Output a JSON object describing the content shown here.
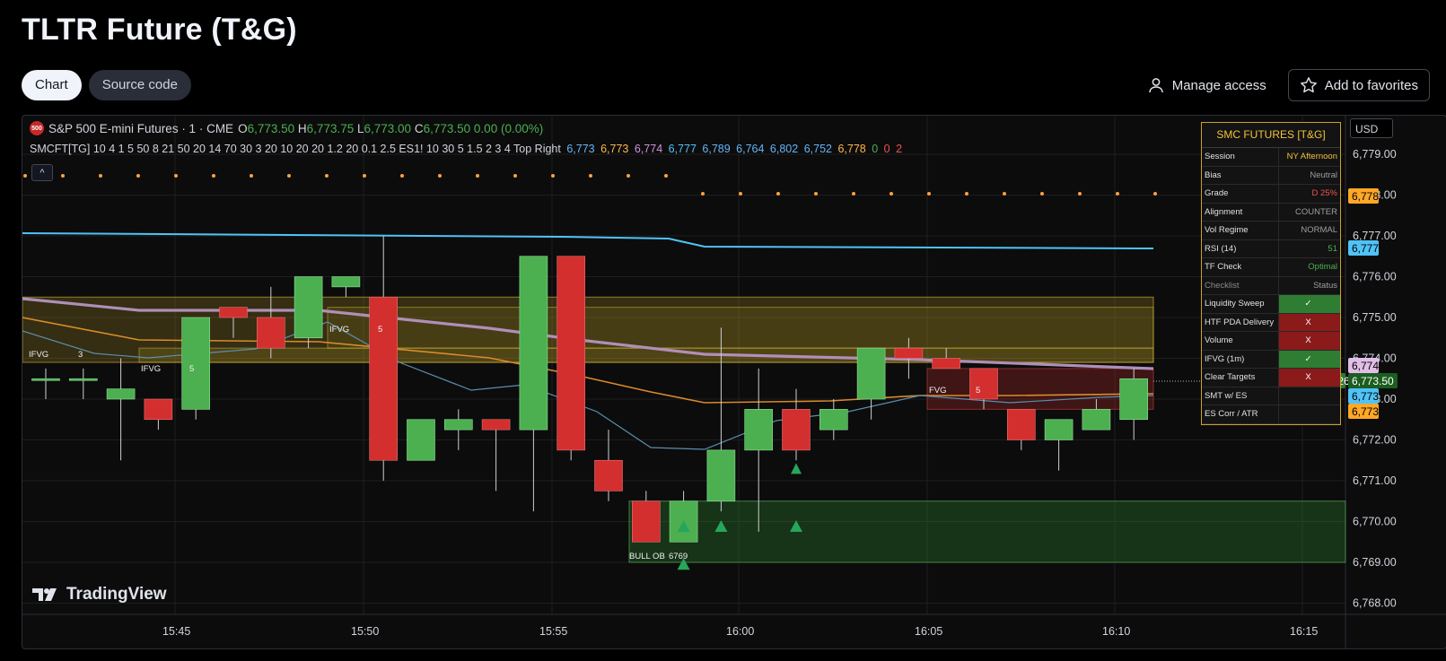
{
  "page": {
    "title": "TLTR Future (T&G)"
  },
  "tabs": [
    {
      "label": "Chart",
      "active": true
    },
    {
      "label": "Source code",
      "active": false
    }
  ],
  "actions": {
    "manage_access": "Manage access",
    "add_favorites": "Add to favorites"
  },
  "chart": {
    "symbol_badge": "500",
    "symbol": "S&P 500 E-mini Futures · 1 · CME",
    "ohlc": {
      "o_label": "O",
      "o": "6,773.50",
      "h_label": "H",
      "h": "6,773.75",
      "l_label": "L",
      "l": "6,773.00",
      "c_label": "C",
      "c": "6,773.50",
      "change": "0.00 (0.00%)"
    },
    "indicator_params": "SMCFT[TG] 10 4 1 5 50 8 21 50 20 14 70 30 3 20 10 20 20 1.2 20 0.1 2.5 ES1! 10 30 5 1.5 2 3 4 Top Right",
    "indicator_values": [
      {
        "text": "6,773",
        "color": "#64b5f6"
      },
      {
        "text": "6,773",
        "color": "#ffb74d"
      },
      {
        "text": "6,774",
        "color": "#ce93d8"
      },
      {
        "text": "6,777",
        "color": "#4fc3f7"
      },
      {
        "text": "6,789",
        "color": "#64b5f6"
      },
      {
        "text": "6,764",
        "color": "#64b5f6"
      },
      {
        "text": "6,802",
        "color": "#64b5f6"
      },
      {
        "text": "6,752",
        "color": "#64b5f6"
      },
      {
        "text": "6,778",
        "color": "#ffb74d"
      },
      {
        "text": "0",
        "color": "#4caf50"
      },
      {
        "text": "0",
        "color": "#ef5350"
      },
      {
        "text": "2",
        "color": "#ef5350"
      }
    ],
    "collapse_glyph": "^",
    "currency": "USD",
    "watermark": "TradingView",
    "y_ticks": [
      "6,779.00",
      "6,778.00",
      "6,777.00",
      "6,776.00",
      "6,775.00",
      "6,774.00",
      "6,773.00",
      "6,772.00",
      "6,771.00",
      "6,770.00",
      "6,769.00",
      "6,768.00"
    ],
    "x_ticks": [
      "15:45",
      "15:50",
      "15:55",
      "16:00",
      "16:05",
      "16:10",
      "16:15"
    ],
    "zone_labels": {
      "ifvg1": "IFVG",
      "ifvg1_num": "3",
      "ifvg2": "IFVG",
      "ifvg2_num": "5",
      "ifvg3": "IFVG",
      "ifvg3_num": "5",
      "fvg": "FVG",
      "fvg_num": "5",
      "bull_ob": "BULL OB",
      "bull_ob_num": "6769"
    },
    "price_tags": {
      "t6778": "6,778",
      "t6777": "6,777",
      "t6774": "6,774",
      "esm_label": "ESM2026",
      "esm_price": "6,773.50",
      "t6773a": "6,773",
      "t6773b": "6,773"
    },
    "colors": {
      "up": "#4caf50",
      "down": "#d32f2f",
      "accent": "#f2c23b",
      "background": "#0c0c0c"
    }
  },
  "smc_panel": {
    "title": "SMC FUTURES  [T&G]",
    "rows": [
      {
        "label": "Session",
        "value": "NY Afternoon",
        "value_color": "#f2c23b"
      },
      {
        "label": "Bias",
        "value": "Neutral"
      },
      {
        "label": "Grade",
        "value": "D  25%",
        "value_color": "#ef5350"
      },
      {
        "label": "Alignment",
        "value": "COUNTER"
      },
      {
        "label": "Vol Regime",
        "value": "NORMAL"
      },
      {
        "label": "RSI (14)",
        "value": "51",
        "value_color": "#4caf50"
      },
      {
        "label": "TF Check",
        "value": "Optimal",
        "value_color": "#4caf50"
      },
      {
        "label": "Checklist",
        "value": "Status",
        "dim": true
      },
      {
        "label": "Liquidity Sweep",
        "value": "✓",
        "cell": "green"
      },
      {
        "label": "HTF PDA Delivery",
        "value": "X",
        "cell": "red"
      },
      {
        "label": "Volume",
        "value": "X",
        "cell": "red"
      },
      {
        "label": "IFVG (1m)",
        "value": "✓",
        "cell": "green"
      },
      {
        "label": "Clear Targets",
        "value": "X",
        "cell": "red"
      },
      {
        "label": "SMT w/ ES",
        "value": ""
      },
      {
        "label": "ES Corr / ATR",
        "value": ""
      }
    ]
  },
  "chart_data": {
    "type": "candlestick",
    "x_ticks": [
      "15:45",
      "15:50",
      "15:55",
      "16:00",
      "16:05",
      "16:10",
      "16:15"
    ],
    "ylim": [
      6768,
      6779
    ],
    "candles": [
      {
        "o": 6773.5,
        "h": 6773.75,
        "l": 6773.0,
        "c": 6773.5
      },
      {
        "o": 6773.5,
        "h": 6773.75,
        "l": 6773.0,
        "c": 6773.5
      },
      {
        "o": 6773.0,
        "h": 6774.0,
        "l": 6771.5,
        "c": 6773.25
      },
      {
        "o": 6773.0,
        "h": 6773.0,
        "l": 6772.25,
        "c": 6772.5
      },
      {
        "o": 6772.75,
        "h": 6775.0,
        "l": 6772.5,
        "c": 6775.0
      },
      {
        "o": 6775.25,
        "h": 6775.25,
        "l": 6774.5,
        "c": 6775.0
      },
      {
        "o": 6775.0,
        "h": 6775.75,
        "l": 6774.0,
        "c": 6774.25
      },
      {
        "o": 6774.5,
        "h": 6775.75,
        "l": 6774.25,
        "c": 6776.0
      },
      {
        "o": 6775.75,
        "h": 6776.0,
        "l": 6775.5,
        "c": 6776.0
      },
      {
        "o": 6775.5,
        "h": 6777.0,
        "l": 6771.0,
        "c": 6771.5
      },
      {
        "o": 6771.5,
        "h": 6772.5,
        "l": 6771.5,
        "c": 6772.5
      },
      {
        "o": 6772.25,
        "h": 6772.75,
        "l": 6771.75,
        "c": 6772.5
      },
      {
        "o": 6772.5,
        "h": 6772.5,
        "l": 6770.75,
        "c": 6772.25
      },
      {
        "o": 6772.25,
        "h": 6776.5,
        "l": 6770.25,
        "c": 6776.5
      },
      {
        "o": 6776.5,
        "h": 6776.5,
        "l": 6771.5,
        "c": 6771.75
      },
      {
        "o": 6771.5,
        "h": 6772.25,
        "l": 6770.5,
        "c": 6770.75
      },
      {
        "o": 6770.5,
        "h": 6770.75,
        "l": 6769.5,
        "c": 6769.5
      },
      {
        "o": 6769.5,
        "h": 6770.75,
        "l": 6769.5,
        "c": 6770.5
      },
      {
        "o": 6770.5,
        "h": 6774.75,
        "l": 6770.25,
        "c": 6771.75
      },
      {
        "o": 6771.75,
        "h": 6773.75,
        "l": 6769.75,
        "c": 6772.75
      },
      {
        "o": 6772.75,
        "h": 6773.25,
        "l": 6771.5,
        "c": 6771.75
      },
      {
        "o": 6772.25,
        "h": 6773.0,
        "l": 6772.0,
        "c": 6772.75
      },
      {
        "o": 6773.0,
        "h": 6774.25,
        "l": 6772.5,
        "c": 6774.25
      },
      {
        "o": 6774.25,
        "h": 6774.5,
        "l": 6773.5,
        "c": 6774.0
      },
      {
        "o": 6774.0,
        "h": 6774.25,
        "l": 6773.75,
        "c": 6773.75
      },
      {
        "o": 6773.75,
        "h": 6773.75,
        "l": 6772.75,
        "c": 6773.0
      },
      {
        "o": 6772.75,
        "h": 6772.75,
        "l": 6771.75,
        "c": 6772.0
      },
      {
        "o": 6772.0,
        "h": 6772.5,
        "l": 6771.25,
        "c": 6772.5
      },
      {
        "o": 6772.25,
        "h": 6773.0,
        "l": 6772.25,
        "c": 6772.75
      },
      {
        "o": 6772.5,
        "h": 6773.75,
        "l": 6772.0,
        "c": 6773.5
      }
    ],
    "series": [
      {
        "name": "6,777",
        "values_note": "",
        "values": [
          6777.0,
          6777.0,
          6776.9,
          6776.8,
          6776.8,
          6776.8,
          6776.8,
          6776.8,
          6776.8,
          6776.8,
          6776.8,
          6776.75,
          6776.75
        ]
      },
      {
        "name": "6,774",
        "values": [
          6775.5,
          6775.2,
          6775.1,
          6775.1,
          6775.0,
          6774.7,
          6774.3,
          6774.0,
          6773.9,
          6773.8,
          6773.75,
          6773.75
        ]
      },
      {
        "name": "6,773",
        "values": [
          6775.0,
          6774.6,
          6774.2,
          6774.0,
          6773.6,
          6773.0,
          6772.6,
          6772.9,
          6773.1,
          6773.2,
          6773.2,
          6773.0
        ]
      }
    ],
    "markers": {
      "bull_triangles_x_index": [
        17,
        18,
        20
      ]
    }
  }
}
